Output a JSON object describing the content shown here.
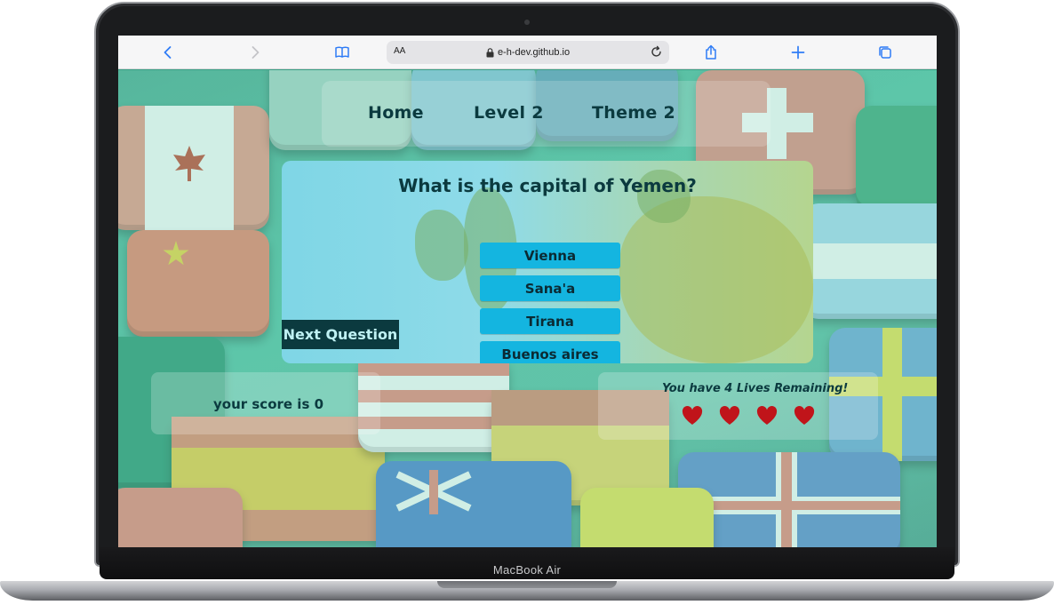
{
  "device": {
    "model_label": "MacBook Air"
  },
  "browser": {
    "text_size_label": "AA",
    "url": "e-h-dev.github.io",
    "icons": [
      "chevron-left-icon",
      "chevron-right-icon",
      "book-icon",
      "lock-icon",
      "reload-icon",
      "share-icon",
      "plus-icon",
      "tabs-icon"
    ]
  },
  "nav": {
    "links": [
      {
        "label": "Home"
      },
      {
        "label": "Level 2"
      },
      {
        "label": "Theme 2"
      }
    ]
  },
  "quiz": {
    "question": "What is the capital of Yemen?",
    "answers": [
      "Vienna",
      "Sana'a",
      "Tirana",
      "Buenos aires"
    ],
    "next_label": "Next Question"
  },
  "score": {
    "text": "your score is 0"
  },
  "lives": {
    "text": "You have 4 Lives Remaining!",
    "count": 4,
    "heart_color": "#c0141a"
  },
  "colors": {
    "accent": "#14b5e0",
    "text_dark": "#0b3a3f"
  }
}
